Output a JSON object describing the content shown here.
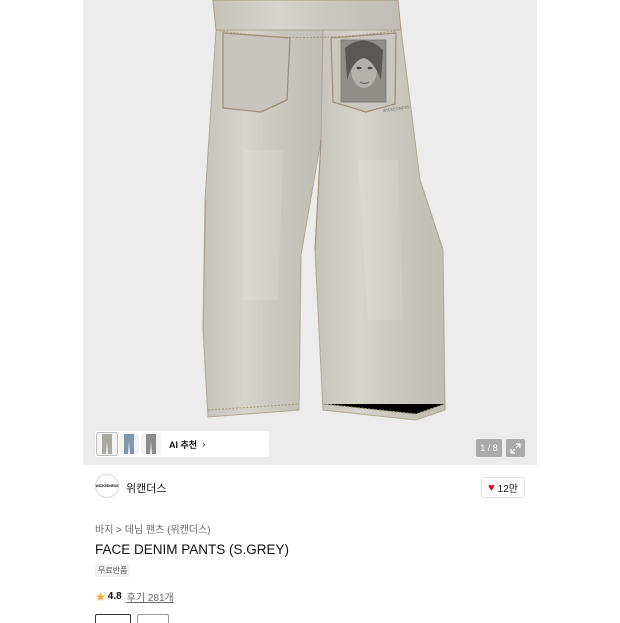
{
  "gallery": {
    "ai_recommend_label": "AI 추천",
    "chevron": "›",
    "counter": "1 / 8",
    "expand_icon": "expand-icon",
    "colors": {
      "denim": "#cfcdc4",
      "denim_shade": "#bdbbb2",
      "stitch": "#a89a7e",
      "background": "#ececec"
    }
  },
  "brand": {
    "logo_text": "WICKEDNESS",
    "name": "위캔더스",
    "likes": "12만",
    "heart_color": "#e4002b"
  },
  "product": {
    "breadcrumb": "바지 > 데님 팬츠 (위캔더스)",
    "title": "FACE DENIM PANTS (S.GREY)",
    "badge": "무료반품",
    "rating": "4.8",
    "reviews": "후기 281개",
    "star_color": "#f5a623"
  }
}
